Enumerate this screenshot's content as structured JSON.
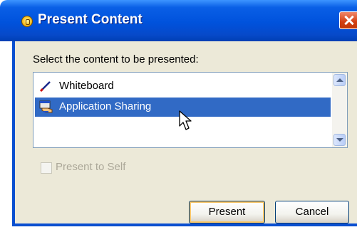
{
  "window": {
    "title": "Present Content",
    "icon": "presentation-bulb-icon",
    "close_icon": "close-icon"
  },
  "prompt": "Select the content to be presented:",
  "content_list": {
    "items": [
      {
        "label": "Whiteboard",
        "icon": "pen-icon",
        "selected": false
      },
      {
        "label": "Application Sharing",
        "icon": "application-sharing-icon",
        "selected": true
      }
    ]
  },
  "options": {
    "present_to_self": {
      "label": "Present to Self",
      "checked": false,
      "enabled": false
    }
  },
  "buttons": {
    "present": "Present",
    "cancel": "Cancel"
  },
  "colors": {
    "title_bar": "#0052dc",
    "selection": "#316ac5",
    "dialog_face": "#ece9d8"
  }
}
